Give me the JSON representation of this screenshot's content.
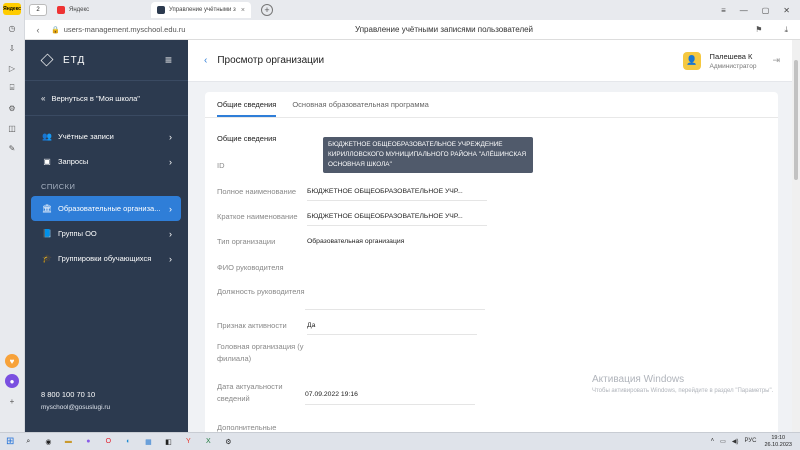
{
  "browser": {
    "tab_counter": "2",
    "tabs": [
      {
        "label": "Яндекс"
      },
      {
        "label": "Управление учётными з"
      }
    ],
    "url": "users-management.myschool.edu.ru",
    "page_title": "Управление учётными записями пользователей"
  },
  "rail": {
    "yandex_badge": "Яндекс"
  },
  "sidebar": {
    "logo": "ЕТД",
    "back_label": "Вернуться в \"Моя школа\"",
    "items_top": [
      {
        "label": "Учётные записи",
        "icon": "users-icon"
      },
      {
        "label": "Запросы",
        "icon": "inbox-icon"
      }
    ],
    "section_label": "СПИСКИ",
    "items_lists": [
      {
        "label": "Образовательные организа...",
        "icon": "bank-icon",
        "active": true
      },
      {
        "label": "Группы ОО",
        "icon": "book-icon"
      },
      {
        "label": "Группировки обучающихся",
        "icon": "graduation-icon"
      }
    ],
    "phone": "8 800 100 70 10",
    "email": "myschool@gosuslugi.ru"
  },
  "header": {
    "title": "Просмотр организации",
    "user_name": "Палешева К",
    "user_role": "Администратор"
  },
  "tabs": [
    {
      "label": "Общие сведения",
      "active": true
    },
    {
      "label": "Основная образовательная программа",
      "active": false
    }
  ],
  "section_title": "Общие сведения",
  "tooltip": "БЮДЖЕТНОЕ ОБЩЕОБРАЗОВАТЕЛЬНОЕ УЧРЕЖДЕНИЕ КИРИЛЛОВСКОГО МУНИЦИПАЛЬНОГО РАЙОНА \"АЛЁШИНСКАЯ ОСНОВНАЯ ШКОЛА\"",
  "fields": [
    {
      "label": "ID",
      "value": ""
    },
    {
      "label": "Полное наименование",
      "value": "БЮДЖЕТНОЕ ОБЩЕОБРАЗОВАТЕЛЬНОЕ УЧР..."
    },
    {
      "label": "Краткое наименование",
      "value": "БЮДЖЕТНОЕ ОБЩЕОБРАЗОВАТЕЛЬНОЕ УЧР..."
    },
    {
      "label": "Тип организации",
      "value": "Образовательная организация"
    },
    {
      "label": "ФИО руководителя",
      "value": ""
    },
    {
      "label": "Должность руководителя",
      "value": ""
    },
    {
      "label": "Признак активности",
      "value": "Да"
    },
    {
      "label": "Головная организация (у филиала)",
      "value": ""
    },
    {
      "label": "Дата актуальности сведений",
      "value": "07.09.2022 19:16"
    },
    {
      "label": "Дополнительные",
      "value": ""
    }
  ],
  "watermark": {
    "title": "Активация Windows",
    "sub": "Чтобы активировать Windows, перейдите в раздел \"Параметры\"."
  },
  "taskbar": {
    "time": "19:10",
    "date": "26.10.2023"
  }
}
